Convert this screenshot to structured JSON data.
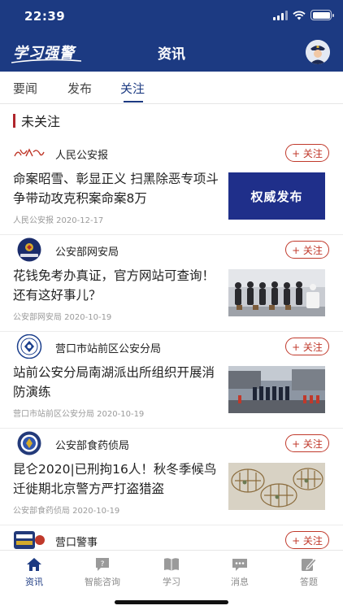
{
  "status_bar": {
    "time": "22:39"
  },
  "app": {
    "logo_text": "学习强警",
    "title": "资讯"
  },
  "tabs": [
    {
      "label": "要闻"
    },
    {
      "label": "发布"
    },
    {
      "label": "关注",
      "active": true
    }
  ],
  "section": {
    "title": "未关注"
  },
  "feed": [
    {
      "source": "人民公安报",
      "follow_label": "+ 关注",
      "headline": "命案昭雪、彰显正义 扫黑除恶专项斗争带动攻克积案命案8万",
      "meta": "人民公安报 2020-12-17",
      "thumb_text": "权威发布",
      "thumb_icon": "blue-banner"
    },
    {
      "source": "公安部网安局",
      "follow_label": "+ 关注",
      "headline": "花钱免考办真证，官方网站可查询！还有这好事儿？",
      "meta": "公安部网安局 2020-10-19",
      "thumb_icon": "people-lineup-photo"
    },
    {
      "source": "营口市站前区公安分局",
      "follow_label": "+ 关注",
      "headline": "站前公安分局南湖派出所组织开展消防演练",
      "meta": "营口市站前区公安分局 2020-10-19",
      "thumb_icon": "fire-drill-photo"
    },
    {
      "source": "公安部食药侦局",
      "follow_label": "+ 关注",
      "headline": "昆仑2020|已刑拘16人！秋冬季候鸟迁徙期北京警方严打盗猎盗",
      "meta": "公安部食药侦局 2020-10-19",
      "thumb_icon": "bird-cages-photo"
    },
    {
      "source": "营口警事",
      "follow_label": "+ 关注"
    }
  ],
  "bottom_nav": [
    {
      "label": "资讯",
      "icon": "home-icon",
      "active": true
    },
    {
      "label": "智能咨询",
      "icon": "chat-question-icon"
    },
    {
      "label": "学习",
      "icon": "book-icon"
    },
    {
      "label": "消息",
      "icon": "message-icon"
    },
    {
      "label": "答题",
      "icon": "edit-icon"
    }
  ],
  "colors": {
    "brand": "#1c3a82",
    "follow": "#c0392b",
    "section_bar": "#b0262c"
  }
}
